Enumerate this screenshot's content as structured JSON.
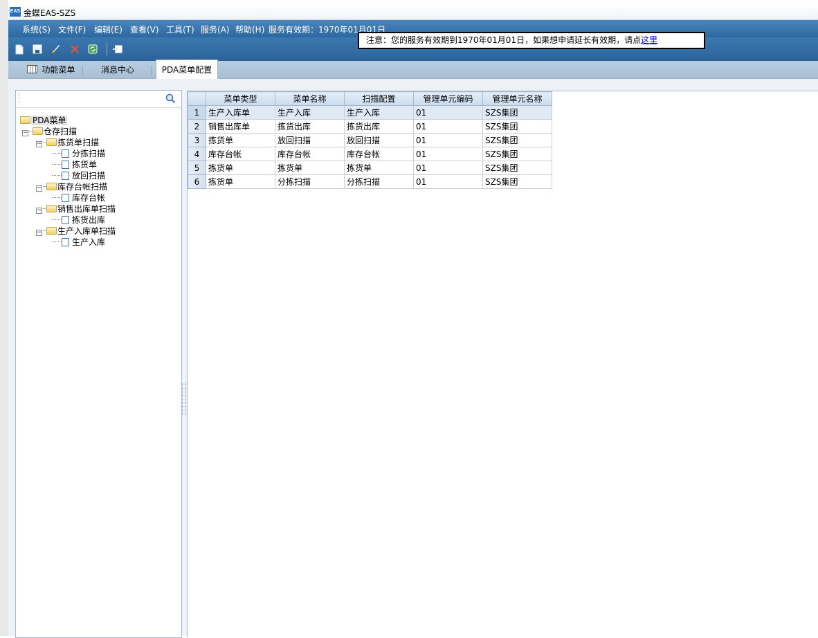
{
  "window": {
    "title": "金蝶EAS-SZS",
    "logo_text": "EAS"
  },
  "menubar": {
    "items": [
      "系统(S)",
      "文件(F)",
      "编辑(E)",
      "查看(V)",
      "工具(T)",
      "服务(A)",
      "帮助(H)"
    ],
    "service_date": "服务有效期：1970年01月01日"
  },
  "notice": {
    "text": "注意：您的服务有效期到1970年01月01日，如果想申请延长有效期，请点",
    "link": "这里"
  },
  "toolbar": {
    "icons": [
      "new-document-icon",
      "save-icon",
      "edit-brush-icon",
      "delete-icon",
      "refresh-icon",
      "export-icon"
    ]
  },
  "tabs": {
    "items": [
      "功能菜单",
      "消息中心",
      "PDA菜单配置"
    ],
    "active": "PDA菜单配置"
  },
  "tree": {
    "search_placeholder": "",
    "root": "PDA菜单",
    "level1": "仓存扫描",
    "groups": [
      {
        "label": "拣货单扫描",
        "children": [
          "分拣扫描",
          "拣货单",
          "放回扫描"
        ]
      },
      {
        "label": "库存台帐扫描",
        "children": [
          "库存台帐"
        ]
      },
      {
        "label": "销售出库单扫描",
        "children": [
          "拣货出库"
        ]
      },
      {
        "label": "生产入库单扫描",
        "children": [
          "生产入库"
        ]
      }
    ]
  },
  "grid": {
    "columns": [
      "菜单类型",
      "菜单名称",
      "扫描配置",
      "管理单元编码",
      "管理单元名称"
    ],
    "selected_row": 1,
    "rows": [
      {
        "num": "1",
        "type": "生产入库单",
        "name": "生产入库",
        "scan": "生产入库",
        "code": "01",
        "unit": "SZS集团"
      },
      {
        "num": "2",
        "type": "销售出库单",
        "name": "拣货出库",
        "scan": "拣货出库",
        "code": "01",
        "unit": "SZS集团"
      },
      {
        "num": "3",
        "type": "拣货单",
        "name": "放回扫描",
        "scan": "放回扫描",
        "code": "01",
        "unit": "SZS集团"
      },
      {
        "num": "4",
        "type": "库存台帐",
        "name": "库存台帐",
        "scan": "库存台帐",
        "code": "01",
        "unit": "SZS集团"
      },
      {
        "num": "5",
        "type": "拣货单",
        "name": "拣货单",
        "scan": "拣货单",
        "code": "01",
        "unit": "SZS集团"
      },
      {
        "num": "6",
        "type": "拣货单",
        "name": "分拣扫描",
        "scan": "分拣扫描",
        "code": "01",
        "unit": "SZS集团"
      }
    ]
  }
}
